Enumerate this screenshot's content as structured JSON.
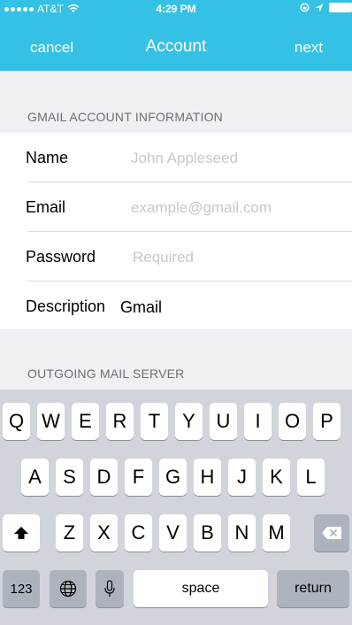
{
  "status_bar": {
    "carrier": "AT&T",
    "time": "4:29 PM"
  },
  "nav": {
    "cancel_label": "cancel",
    "title": "Account",
    "next_label": "next"
  },
  "sections": {
    "account_header": "GMAIL ACCOUNT INFORMATION",
    "outgoing_header": "OUTGOING MAIL SERVER"
  },
  "form": {
    "name": {
      "label": "Name",
      "placeholder": "John Appleseed",
      "value": ""
    },
    "email": {
      "label": "Email",
      "placeholder": "example@gmail.com",
      "value": ""
    },
    "password": {
      "label": "Password",
      "placeholder": "Required",
      "value": ""
    },
    "description": {
      "label": "Description",
      "placeholder": "",
      "value": "Gmail"
    }
  },
  "keyboard": {
    "row1": [
      "Q",
      "W",
      "E",
      "R",
      "T",
      "Y",
      "U",
      "I",
      "O",
      "P"
    ],
    "row2": [
      "A",
      "S",
      "D",
      "F",
      "G",
      "H",
      "J",
      "K",
      "L"
    ],
    "row3": [
      "Z",
      "X",
      "C",
      "V",
      "B",
      "N",
      "M"
    ],
    "numbers_label": "123",
    "space_label": "space",
    "return_label": "return"
  },
  "colors": {
    "accent": "#35c1e5",
    "background": "#efeff4",
    "keyboard": "#d1d5db"
  },
  "icons": [
    "signal-dots-icon",
    "wifi-icon",
    "lock-rotation-icon",
    "location-icon",
    "battery-icon",
    "shift-icon",
    "delete-icon",
    "globe-icon",
    "microphone-icon"
  ]
}
